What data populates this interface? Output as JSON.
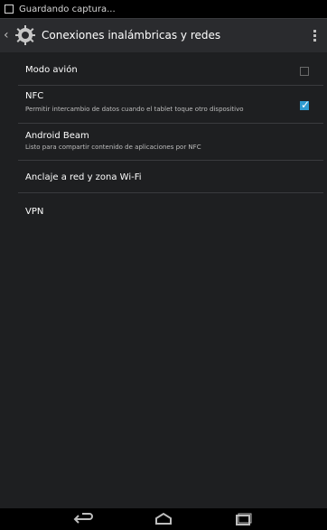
{
  "status_bar": {
    "notification_text": "Guardando captura...",
    "notification_icon": "screenshot-icon"
  },
  "action_bar": {
    "title": "Conexiones inalámbricas y redes",
    "app_icon": "settings-gear-icon",
    "overflow_icon": "overflow-menu-icon"
  },
  "settings": [
    {
      "title": "Modo avión",
      "summary": "",
      "checkbox": true,
      "checked": false
    },
    {
      "title": "NFC",
      "summary": "Permitir intercambio de datos cuando el tablet toque otro dispositivo",
      "checkbox": true,
      "checked": true
    },
    {
      "title": "Android Beam",
      "summary": "Listo para compartir contenido de aplicaciones por NFC",
      "checkbox": false,
      "checked": false
    },
    {
      "title": "Anclaje a red y zona Wi-Fi",
      "summary": "",
      "checkbox": false,
      "checked": false
    },
    {
      "title": "VPN",
      "summary": "",
      "checkbox": false,
      "checked": false
    }
  ],
  "nav_bar": {
    "back_icon": "back-icon",
    "home_icon": "home-icon",
    "recents_icon": "recents-icon"
  },
  "colors": {
    "accent": "#2f9bd0",
    "background": "#1e1f21",
    "action_bar": "#2a2b2e"
  }
}
